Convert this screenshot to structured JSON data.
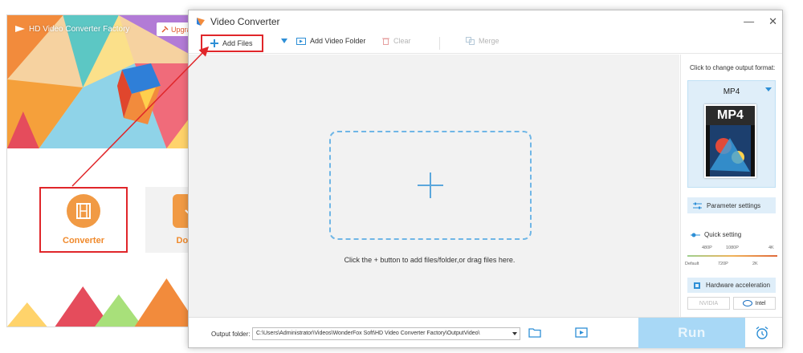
{
  "launcher": {
    "title": "HD Video Converter Factory",
    "upgrade_label": "Upgrade",
    "tiles": [
      {
        "label": "Converter",
        "highlighted": true
      },
      {
        "label": "Downl"
      }
    ]
  },
  "window": {
    "title": "Video Converter",
    "controls": {
      "minimize": "—",
      "close": "✕"
    }
  },
  "toolbar": {
    "add_files": "Add Files",
    "add_video_folder": "Add Video Folder",
    "clear": "Clear",
    "merge": "Merge"
  },
  "dropzone": {
    "hint": "Click the + button to add files/folder,or drag files here."
  },
  "format_panel": {
    "caption": "Click to change output format:",
    "format": "MP4",
    "thumbnail_label": "MP4",
    "parameter_settings": "Parameter settings",
    "quick_setting": "Quick setting",
    "quality_top": [
      "480P",
      "1080P",
      "4K"
    ],
    "quality_bottom": [
      "Default",
      "720P",
      "2K"
    ],
    "hardware_acceleration": "Hardware acceleration",
    "gpu_nvidia": "NVIDIA",
    "gpu_intel": "Intel"
  },
  "footer": {
    "output_label": "Output folder:",
    "output_path": "C:\\Users\\Administrator\\Videos\\WonderFox Soft\\HD Video Converter Factory\\OutputVideo\\",
    "run": "Run"
  },
  "colors": {
    "highlight": "#e0262a",
    "accent": "#2e8fd6",
    "orange": "#f08a2c",
    "run_bg": "#a8d8f6"
  }
}
